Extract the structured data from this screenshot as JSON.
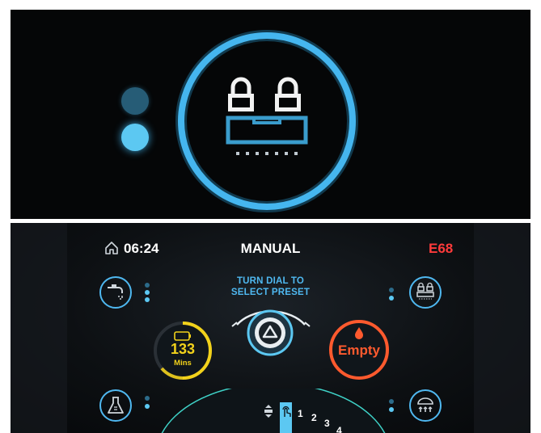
{
  "top_panel": {
    "icon": "lock-lock-spray-icon",
    "indicators": [
      {
        "state": "inactive",
        "color": "#2c6b8a"
      },
      {
        "state": "active",
        "color": "#5cc8f2"
      }
    ],
    "ring_color": "#45b6ef"
  },
  "header": {
    "home_icon": "home-icon",
    "time": "06:24",
    "mode": "MANUAL",
    "error_code": "E68",
    "error_color": "#ff3b3b"
  },
  "prompt": {
    "line1": "TURN DIAL TO",
    "line2": "SELECT PRESET"
  },
  "center_button": {
    "icon": "triangle-up-icon"
  },
  "timer_gauge": {
    "value": "133",
    "unit": "Mins",
    "icon": "battery-icon",
    "color": "#f2d21b"
  },
  "tank_gauge": {
    "value": "Empty",
    "icon": "water-drop-icon",
    "color": "#ff5a2e"
  },
  "side_buttons": [
    {
      "position": "top-left",
      "icon": "faucet-icon",
      "dots": 3
    },
    {
      "position": "top-right",
      "icon": "lock-lock-spray-icon",
      "dots": 2
    },
    {
      "position": "bottom-left",
      "icon": "flask-icon",
      "dots": 2
    },
    {
      "position": "bottom-right",
      "icon": "shower-icon",
      "dots": 2
    }
  ],
  "dial": {
    "icons": [
      "updown-icon",
      "touch-icon"
    ],
    "numbers": [
      "1",
      "2",
      "3",
      "4"
    ]
  },
  "colors": {
    "accent": "#4fb8f0",
    "dot_inactive": "#2c6b8a"
  }
}
